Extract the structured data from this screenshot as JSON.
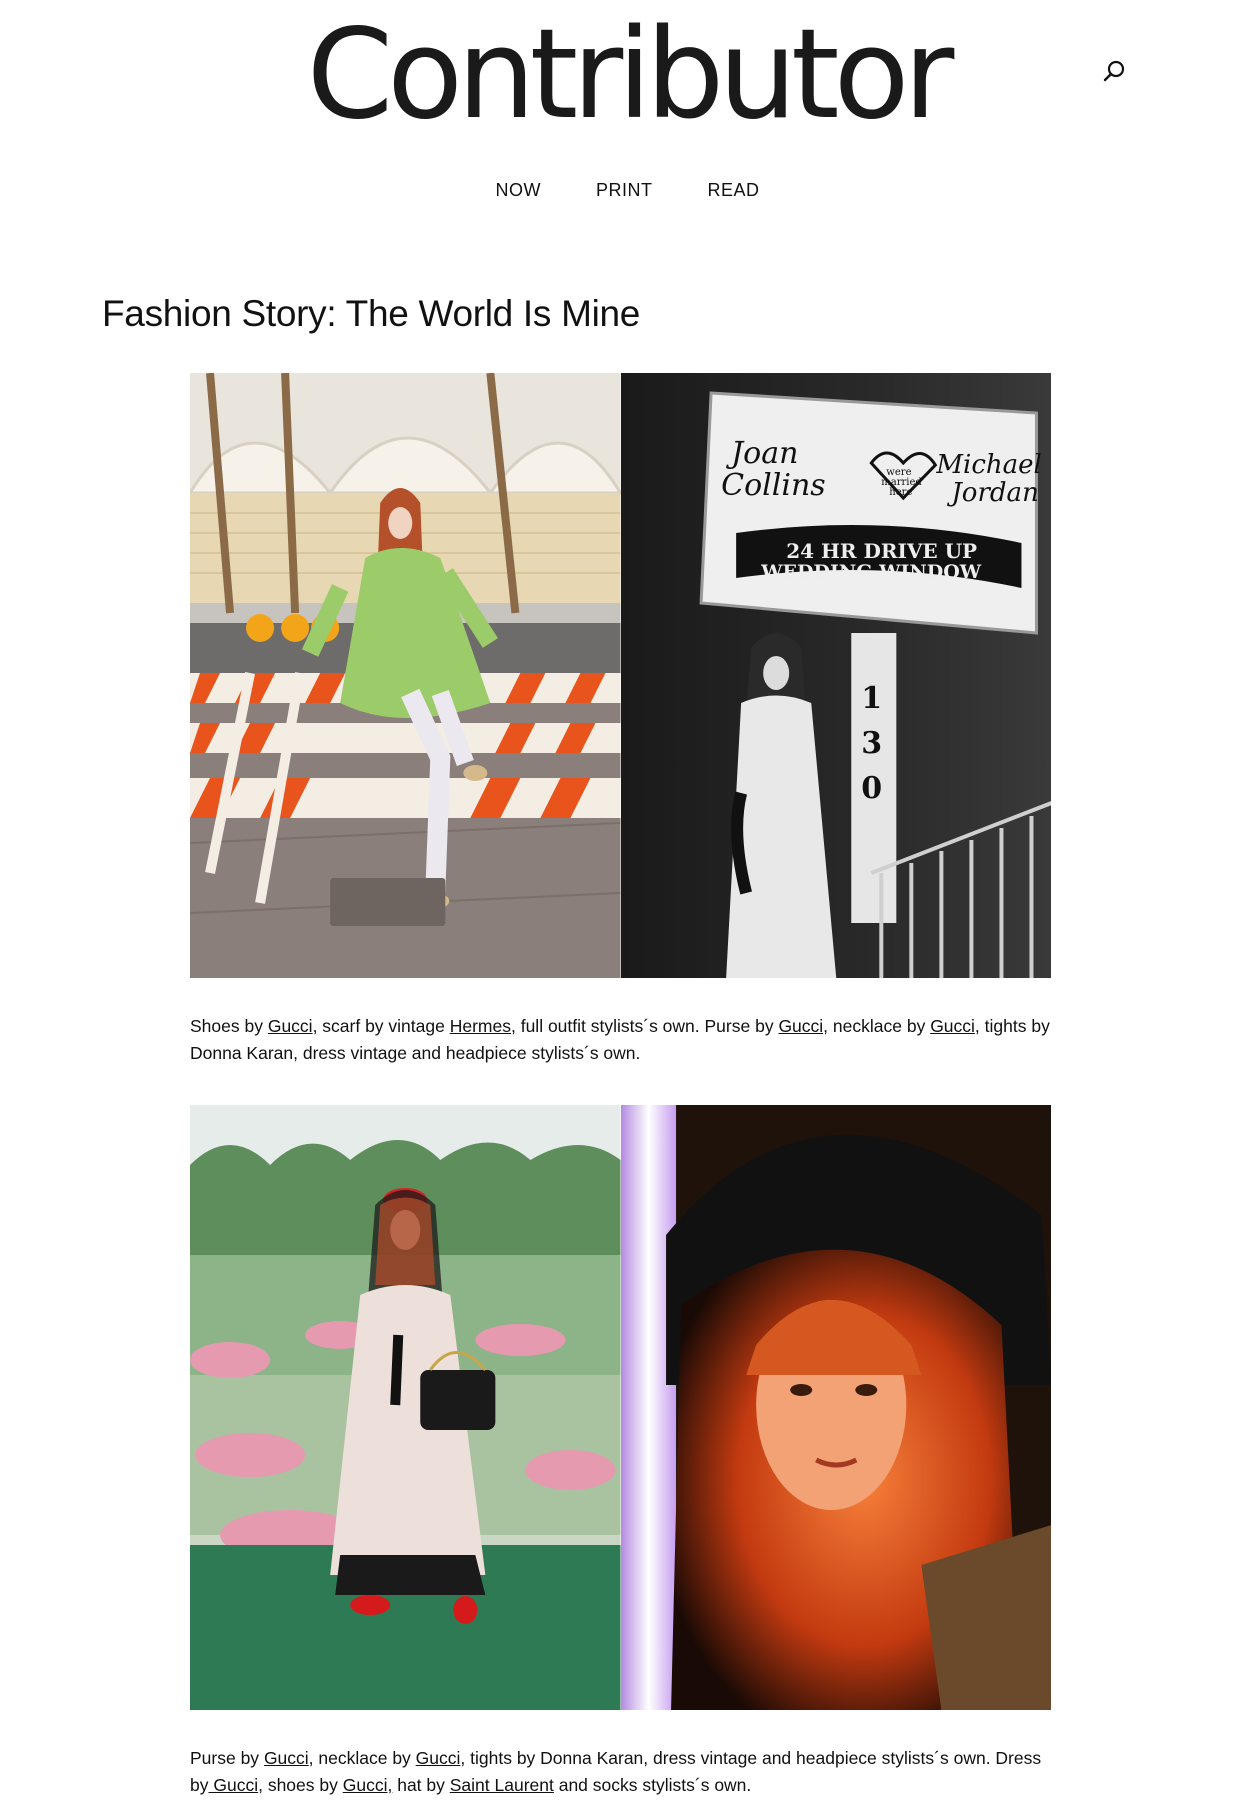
{
  "header": {
    "logo_text": "Contributor",
    "search_icon": "search-icon"
  },
  "nav": {
    "items": [
      {
        "label": "NOW"
      },
      {
        "label": "PRINT"
      },
      {
        "label": "READ"
      }
    ]
  },
  "article": {
    "title": "Fashion Story: The World Is Mine",
    "photo_rows": [
      {
        "left": {
          "description": "Model in green dress on striped road barricade"
        },
        "right": {
          "description": "Model in white gown under wedding chapel sign",
          "sign_names_left": "Joan Collins",
          "sign_heart": "were married here",
          "sign_names_right": "Michael Jordan",
          "sign_banner_line1": "24 HR DRIVE UP",
          "sign_banner_line2": "WEDDING WINDOW",
          "sign_number": "1\n3\n0"
        }
      },
      {
        "left": {
          "description": "Model with veil and black quilted bag before painted garden backdrop"
        },
        "right": {
          "description": "Close-up portrait of model in wide-brim hat lit by neon"
        }
      }
    ],
    "captions": [
      {
        "segments": [
          {
            "text": "Shoes by "
          },
          {
            "text": "Gucci",
            "link": true
          },
          {
            "text": ", scarf by vintage "
          },
          {
            "text": "Hermes",
            "link": true
          },
          {
            "text": ", full outfit stylists´s own. Purse by "
          },
          {
            "text": "Gucci,",
            "link": true
          },
          {
            "text": " necklace by "
          },
          {
            "text": "Gucci",
            "link": true
          },
          {
            "text": ", tights by Donna Karan, dress vintage and headpiece stylists´s own."
          }
        ]
      },
      {
        "segments": [
          {
            "text": "Purse by "
          },
          {
            "text": "Gucci",
            "link": true
          },
          {
            "text": ", necklace by "
          },
          {
            "text": "Gucci",
            "link": true
          },
          {
            "text": ", tights by Donna Karan, dress vintage and headpiece stylists´s own. Dress by"
          },
          {
            "text": " Gucci",
            "link": true
          },
          {
            "text": ", shoes by "
          },
          {
            "text": "Gucci,",
            "link": true
          },
          {
            "text": " hat by "
          },
          {
            "text": "Saint Laurent",
            "link": true
          },
          {
            "text": " and socks stylists´s own."
          }
        ]
      }
    ]
  },
  "colors": {
    "text": "#111111",
    "background": "#ffffff",
    "barricade_orange": "#e8541c",
    "dress_green": "#9ccb6a",
    "neon_orange": "#f05a1a"
  }
}
